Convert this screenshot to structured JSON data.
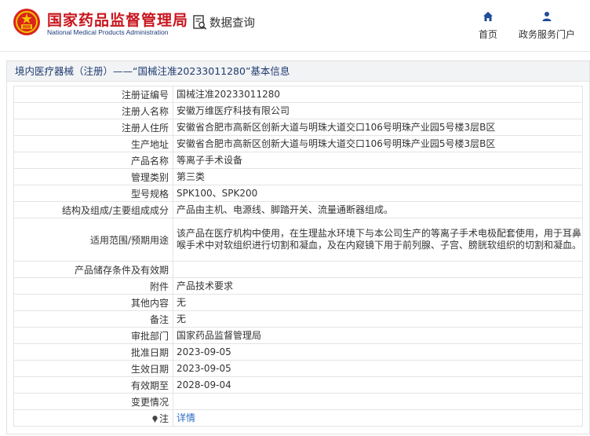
{
  "header": {
    "title": "国家药品监督管理局",
    "subtitle": "National Medical Products Administration",
    "search_label": "数据查询",
    "nav": [
      {
        "label": "首页",
        "icon": "home-icon"
      },
      {
        "label": "政务服务门户",
        "icon": "user-icon"
      }
    ]
  },
  "panel": {
    "title": "境内医疗器械（注册）——“国械注准20233011280”基本信息"
  },
  "rows": [
    {
      "label": "注册证编号",
      "value": "国械注准20233011280"
    },
    {
      "label": "注册人名称",
      "value": "安徽万维医疗科技有限公司"
    },
    {
      "label": "注册人住所",
      "value": "安徽省合肥市高新区创新大道与明珠大道交口106号明珠产业园5号楼3层B区"
    },
    {
      "label": "生产地址",
      "value": "安徽省合肥市高新区创新大道与明珠大道交口106号明珠产业园5号楼3层B区"
    },
    {
      "label": "产品名称",
      "value": "等离子手术设备"
    },
    {
      "label": "管理类别",
      "value": "第三类"
    },
    {
      "label": "型号规格",
      "value": "SPK100、SPK200"
    },
    {
      "label": "结构及组成/主要组成成分",
      "value": "产品由主机、电源线、脚踏开关、流量通断器组成。"
    },
    {
      "label": "适用范围/预期用途",
      "value": "该产品在医疗机构中使用，在生理盐水环境下与本公司生产的等离子手术电极配套使用，用于耳鼻喉手术中对软组织进行切割和凝血，及在内窥镜下用于前列腺、子宫、膀胱软组织的切割和凝血。"
    },
    {
      "label": "产品储存条件及有效期",
      "value": ""
    },
    {
      "label": "附件",
      "value": "产品技术要求"
    },
    {
      "label": "其他内容",
      "value": "无"
    },
    {
      "label": "备注",
      "value": "无"
    },
    {
      "label": "审批部门",
      "value": "国家药品监督管理局"
    },
    {
      "label": "批准日期",
      "value": "2023-09-05"
    },
    {
      "label": "生效日期",
      "value": "2023-09-05"
    },
    {
      "label": "有效期至",
      "value": "2028-09-04"
    },
    {
      "label": "变更情况",
      "value": ""
    },
    {
      "label": "注",
      "value": "详情"
    }
  ]
}
